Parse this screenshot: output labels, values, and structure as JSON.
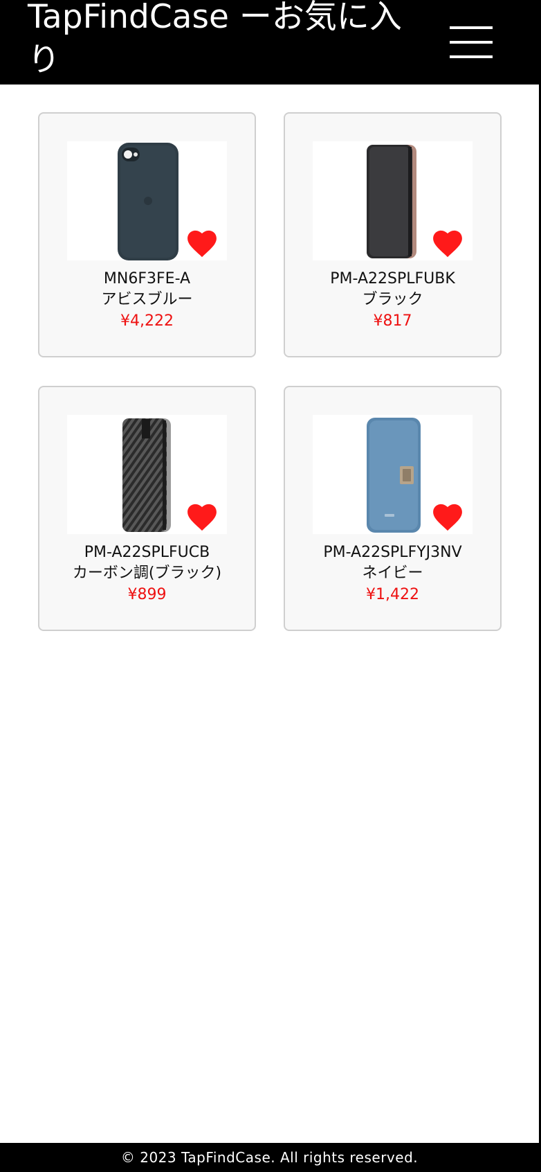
{
  "header": {
    "title": "TapFindCase ーお気に入り",
    "menu_icon": "hamburger-menu-icon"
  },
  "colors": {
    "header_bg": "#000000",
    "price": "#ee1111",
    "heart": "#ff1a1a",
    "card_bg": "#f8f8f8",
    "card_border": "#cfcfcf"
  },
  "favorites": [
    {
      "model": "MN6F3FE-A",
      "color": "アビスブルー",
      "price": "¥4,222",
      "favorite_icon": "heart-icon"
    },
    {
      "model": "PM-A22SPLFUBK",
      "color": "ブラック",
      "price": "¥817",
      "favorite_icon": "heart-icon"
    },
    {
      "model": "PM-A22SPLFUCB",
      "color": "カーボン調(ブラック)",
      "price": "¥899",
      "favorite_icon": "heart-icon"
    },
    {
      "model": "PM-A22SPLFYJ3NV",
      "color": "ネイビー",
      "price": "¥1,422",
      "favorite_icon": "heart-icon"
    }
  ],
  "footer": {
    "copyright": "© 2023 TapFindCase. All rights reserved."
  }
}
